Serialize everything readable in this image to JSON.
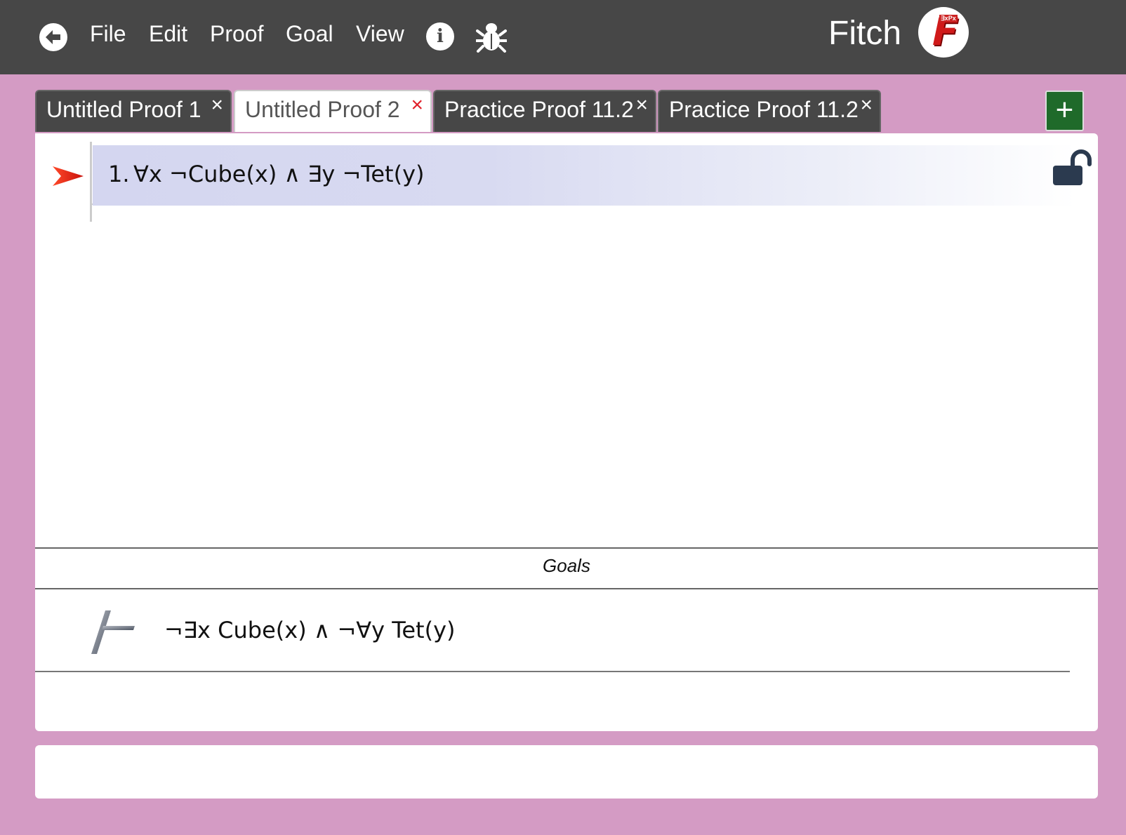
{
  "menubar": {
    "items": [
      "File",
      "Edit",
      "Proof",
      "Goal",
      "View"
    ],
    "info_glyph": "i",
    "app_title": "Fitch",
    "logo_letter": "F",
    "logo_mini_text": "∃xPx",
    "back_icon": "arrow-left-circle-icon",
    "bug_icon": "bug-icon",
    "background_color": "#474747"
  },
  "tabs": [
    {
      "label": "Untitled Proof 1",
      "close": "×",
      "active": false
    },
    {
      "label": "Untitled Proof 2",
      "close": "×",
      "active": true
    },
    {
      "label": "Practice Proof 11.2",
      "close": "×",
      "active": false
    },
    {
      "label": "Practice Proof 11.2",
      "close": "×",
      "active": false
    }
  ],
  "add_tab_label": "+",
  "proof": {
    "lines": [
      {
        "number": "1.",
        "formula": "∀x ¬Cube(x) ∧ ∃y ¬Tet(y)"
      }
    ],
    "focus_icon": "red-arrow-icon",
    "lock_icon": "unlocked-padlock-icon"
  },
  "goals": {
    "header": "Goals",
    "items": [
      {
        "formula": "¬∃x Cube(x) ∧ ¬∀y Tet(y)"
      }
    ]
  },
  "status": {
    "text": ""
  },
  "colors": {
    "page_background": "#d49bc4",
    "add_tab": "#1f6a2a",
    "close_active": "#e0202a",
    "focus_line_highlight": "#d4d6f0"
  }
}
